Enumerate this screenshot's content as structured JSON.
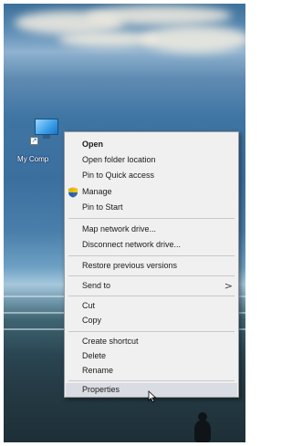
{
  "desktop": {
    "icon": {
      "label": "My Comp",
      "icon_name": "this-pc-icon"
    }
  },
  "context_menu": {
    "items": [
      {
        "label": "Open",
        "bold": true
      },
      {
        "label": "Open folder location"
      },
      {
        "label": "Pin to Quick access"
      },
      {
        "label": "Manage",
        "icon": "uac-shield-icon"
      },
      {
        "label": "Pin to Start"
      },
      {
        "label": "Map network drive..."
      },
      {
        "label": "Disconnect network drive..."
      },
      {
        "label": "Restore previous versions"
      },
      {
        "label": "Send to",
        "submenu_arrow": ">"
      },
      {
        "label": "Cut"
      },
      {
        "label": "Copy"
      },
      {
        "label": "Create shortcut"
      },
      {
        "label": "Delete"
      },
      {
        "label": "Rename"
      },
      {
        "label": "Properties",
        "highlighted": true
      }
    ],
    "colors": {
      "background": "#f0f0f0",
      "border": "#9a9a9a",
      "highlight": "#d9dde3",
      "shield_blue": "#1f5fbf",
      "shield_yellow": "#f2c200"
    }
  },
  "cursor": {
    "icon_name": "pointer-arrow-icon"
  }
}
